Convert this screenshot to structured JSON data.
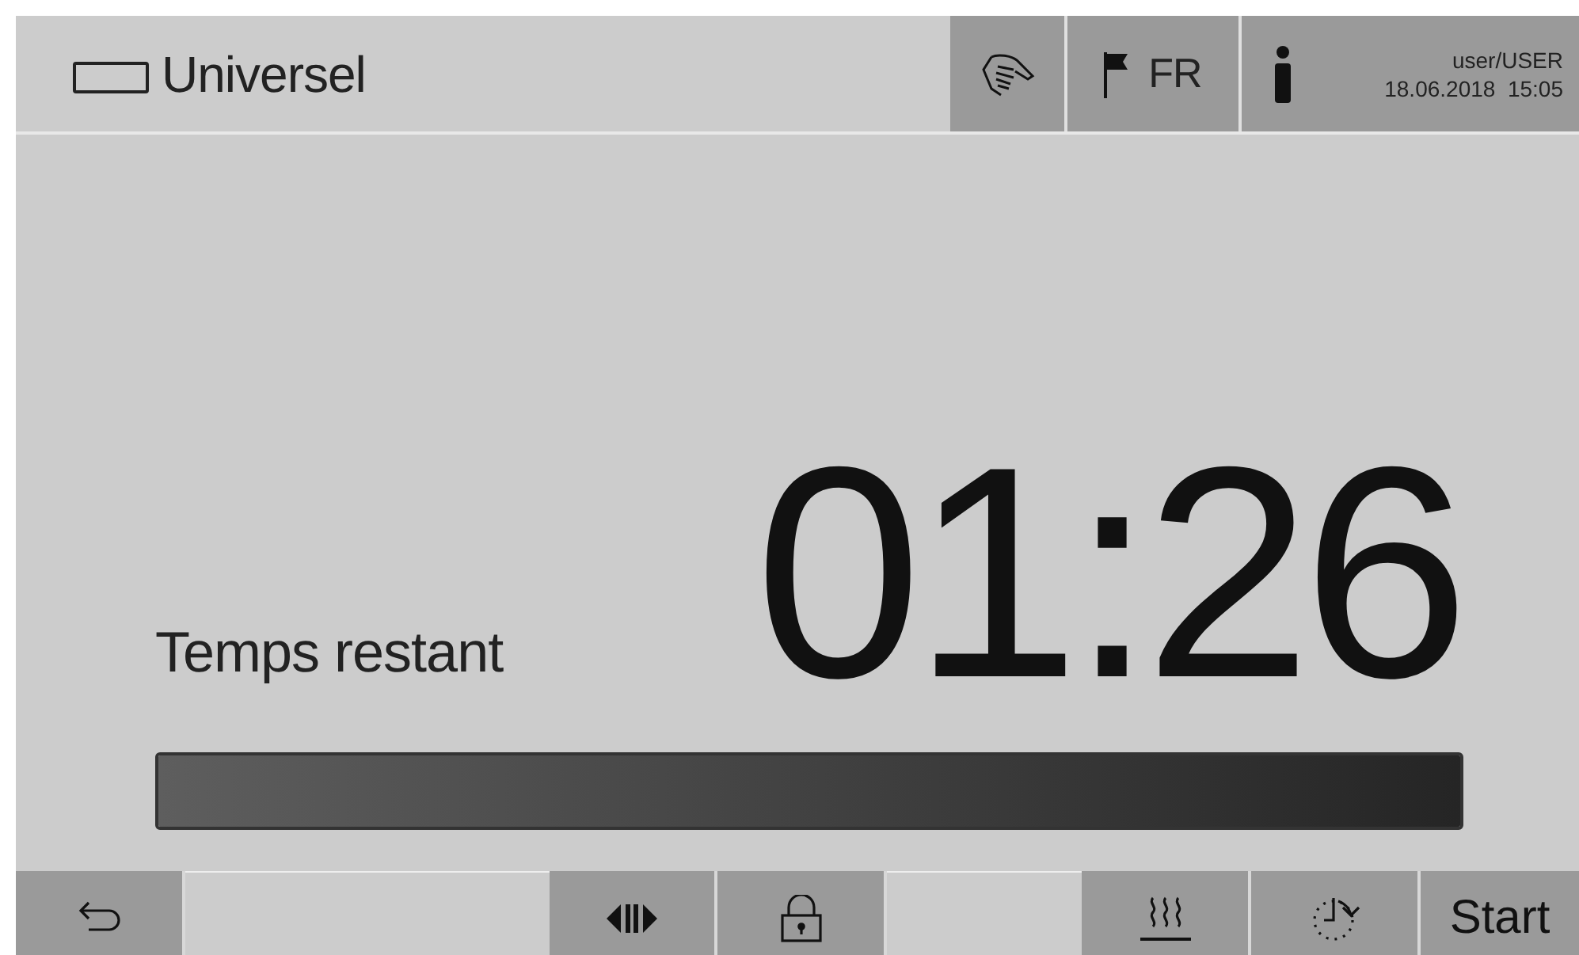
{
  "header": {
    "title": "Universel",
    "language": "FR",
    "user": "user/USER",
    "datetime": "18.06.2018  15:05"
  },
  "timer": {
    "label": "Temps restant",
    "value": "01:26"
  },
  "progress": {
    "level": 1
  },
  "footer": [
    {
      "kind": "back"
    },
    {
      "kind": "blank"
    },
    {
      "kind": "pause"
    },
    {
      "kind": "lock"
    },
    {
      "kind": "blank"
    },
    {
      "kind": "heat"
    },
    {
      "kind": "delay"
    },
    {
      "kind": "text",
      "label": "Start"
    }
  ]
}
